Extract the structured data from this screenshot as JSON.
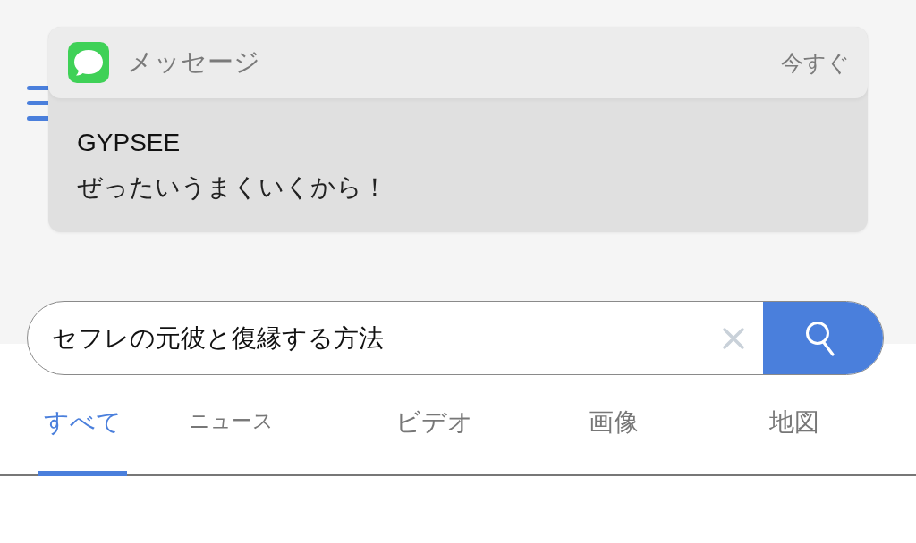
{
  "notification": {
    "app_name": "メッセージ",
    "time": "今すぐ",
    "sender": "GYPSEE",
    "message": "ぜったいうまくいくから！"
  },
  "search": {
    "value": "セフレの元彼と復縁する方法"
  },
  "tabs": [
    {
      "label": "すべて",
      "selected": true
    },
    {
      "label": "ニュース",
      "selected": false
    },
    {
      "label": "ビデオ",
      "selected": false
    },
    {
      "label": "画像",
      "selected": false
    },
    {
      "label": "地図",
      "selected": false
    }
  ]
}
